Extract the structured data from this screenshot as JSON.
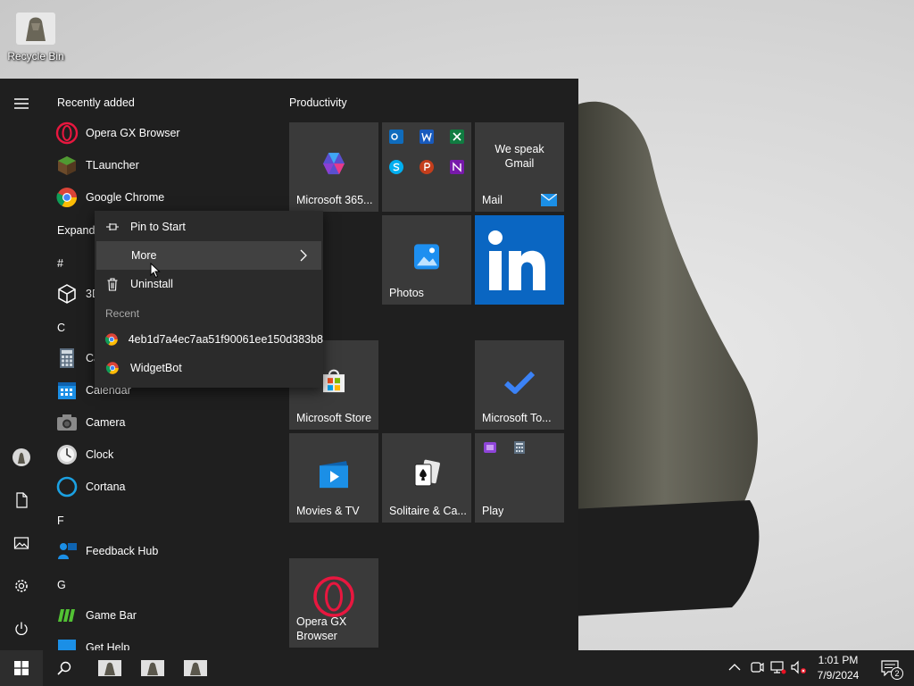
{
  "desktop": {
    "recycle_bin_label": "Recycle Bin"
  },
  "start_menu": {
    "recently_added_header": "Recently added",
    "recent_apps": [
      {
        "label": "Opera GX Browser",
        "icon": "opera-gx-icon"
      },
      {
        "label": "TLauncher",
        "icon": "tlauncher-icon"
      },
      {
        "label": "Google Chrome",
        "icon": "chrome-icon"
      }
    ],
    "expand_label": "Expand",
    "sections": {
      "hash": "#",
      "c": "C",
      "f": "F",
      "g": "G"
    },
    "apps": {
      "three_d": "3D Viewer",
      "calculator": "Calculator",
      "calendar": "Calendar",
      "camera": "Camera",
      "clock": "Clock",
      "cortana": "Cortana",
      "feedback_hub": "Feedback Hub",
      "game_bar": "Game Bar",
      "get_help": "Get Help"
    },
    "tiles": {
      "group_label": "Productivity",
      "m365": "Microsoft 365...",
      "mail_promo_line1": "We speak",
      "mail_promo_line2": "Gmail",
      "mail": "Mail",
      "photos": "Photos",
      "store": "Microsoft Store",
      "todo": "Microsoft To...",
      "movies": "Movies & TV",
      "solitaire": "Solitaire & Ca...",
      "play": "Play",
      "opera_line1": "Opera GX",
      "opera_line2": "Browser"
    }
  },
  "context_menu": {
    "pin_to_start": "Pin to Start",
    "more": "More",
    "uninstall": "Uninstall",
    "recent_header": "Recent",
    "recent_items": [
      "4eb1d7a4ec7aa51f90061ee150d383b8",
      "WidgetBot"
    ]
  },
  "taskbar": {
    "time": "1:01 PM",
    "date": "7/9/2024",
    "notification_count": "2"
  },
  "colors": {
    "accent_blue": "#0a66c2",
    "start_bg": "#1f1f1f",
    "tile_bg": "#3a3a3a",
    "taskbar_bg": "#202020"
  }
}
